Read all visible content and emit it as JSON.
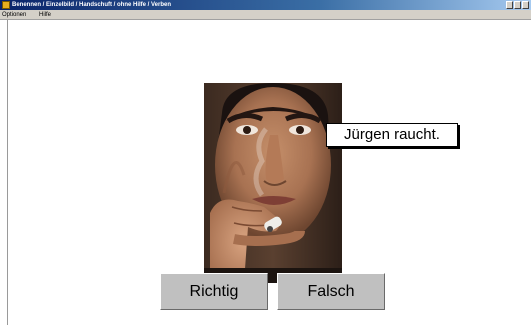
{
  "window": {
    "title": "Benennen / Einzelbild / Handschuft / ohne Hilfe / Verben"
  },
  "menu": {
    "items": [
      "Optionen",
      "Hilfe"
    ]
  },
  "exercise": {
    "sentence": "Jürgen raucht.",
    "buttons": {
      "correct": "Richtig",
      "wrong": "Falsch"
    }
  },
  "colors": {
    "titlebar_start": "#0a246a",
    "titlebar_end": "#a6caf0",
    "button_face": "#c0c0c0"
  }
}
